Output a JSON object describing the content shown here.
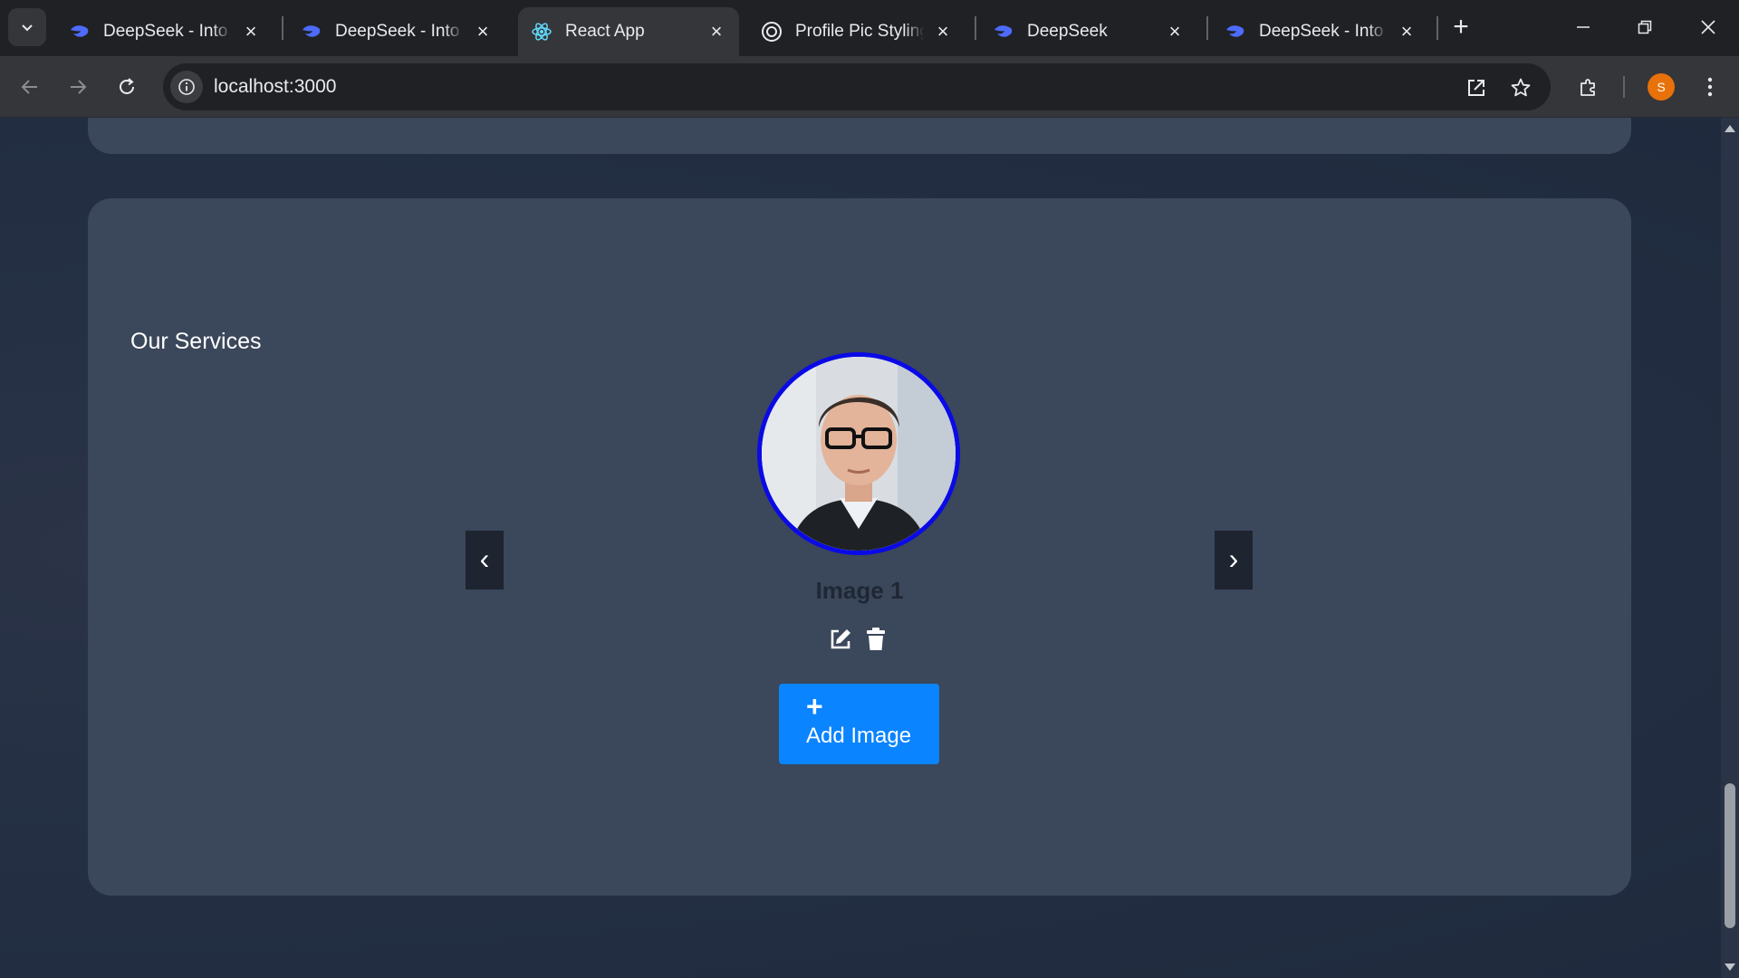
{
  "browser": {
    "tabs": [
      {
        "title": "DeepSeek - Into the",
        "favicon": "deepseek-icon",
        "active": false
      },
      {
        "title": "DeepSeek - Into the",
        "favicon": "deepseek-icon",
        "active": false
      },
      {
        "title": "React App",
        "favicon": "react-icon",
        "active": true
      },
      {
        "title": "Profile Pic Styling /",
        "favicon": "openai-icon",
        "active": false
      },
      {
        "title": "DeepSeek",
        "favicon": "deepseek-icon",
        "active": false
      },
      {
        "title": "DeepSeek - Into the",
        "favicon": "deepseek-icon",
        "active": false
      }
    ],
    "address": "localhost:3000",
    "profile_initial": "S"
  },
  "page": {
    "section_title": "Our Services",
    "carousel": {
      "prev_label": "‹",
      "next_label": "›",
      "current_image_label": "Image 1"
    },
    "add_button": {
      "icon": "+",
      "label": "Add Image"
    }
  },
  "colors": {
    "accent_blue": "#0a84ff",
    "profile_ring": "#0a0ae6",
    "card_bg": "#3b475a",
    "page_bg": "#253045"
  }
}
